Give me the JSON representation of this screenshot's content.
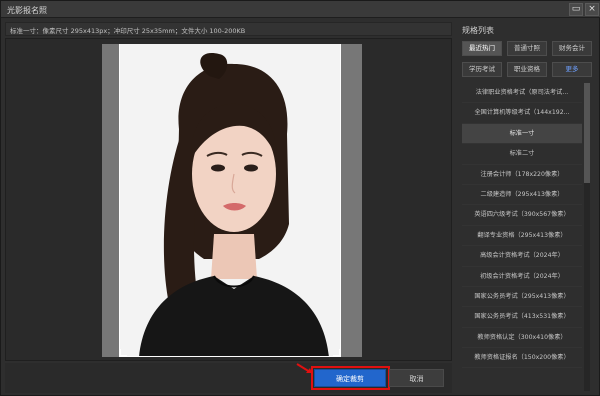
{
  "window": {
    "title": "光影报名照",
    "minimize_glyph": "▭",
    "close_glyph": "×"
  },
  "spec_bar": {
    "text": "标准一寸：像素尺寸 295x413px；冲印尺寸 25x35mm；文件大小 100-200KB"
  },
  "buttons": {
    "confirm": "确定裁剪",
    "cancel": "取消"
  },
  "sidebar": {
    "heading": "规格列表",
    "tabs": [
      {
        "label": "最近热门"
      },
      {
        "label": "普通寸照"
      },
      {
        "label": "财务会计"
      },
      {
        "label": "学历考试"
      },
      {
        "label": "职业资格"
      },
      {
        "label": "更多"
      }
    ],
    "items": [
      {
        "label": "法律职业资格考试（原司法考试..."
      },
      {
        "label": "全国计算机等级考试（144x192..."
      },
      {
        "label": "标准一寸"
      },
      {
        "label": "标准二寸"
      },
      {
        "label": "注册会计师（178x220像素）"
      },
      {
        "label": "二级建造师（295x413像素）"
      },
      {
        "label": "英语四六级考试（390x567像素）"
      },
      {
        "label": "翻译专业资格（295x413像素）"
      },
      {
        "label": "高级会计资格考试（2024年）"
      },
      {
        "label": "初级会计资格考试（2024年）"
      },
      {
        "label": "国家公务员考试（295x413像素）"
      },
      {
        "label": "国家公务员考试（413x531像素）"
      },
      {
        "label": "教师资格认定（300x410像素）"
      },
      {
        "label": "教师资格证报名（150x200像素）"
      }
    ]
  }
}
